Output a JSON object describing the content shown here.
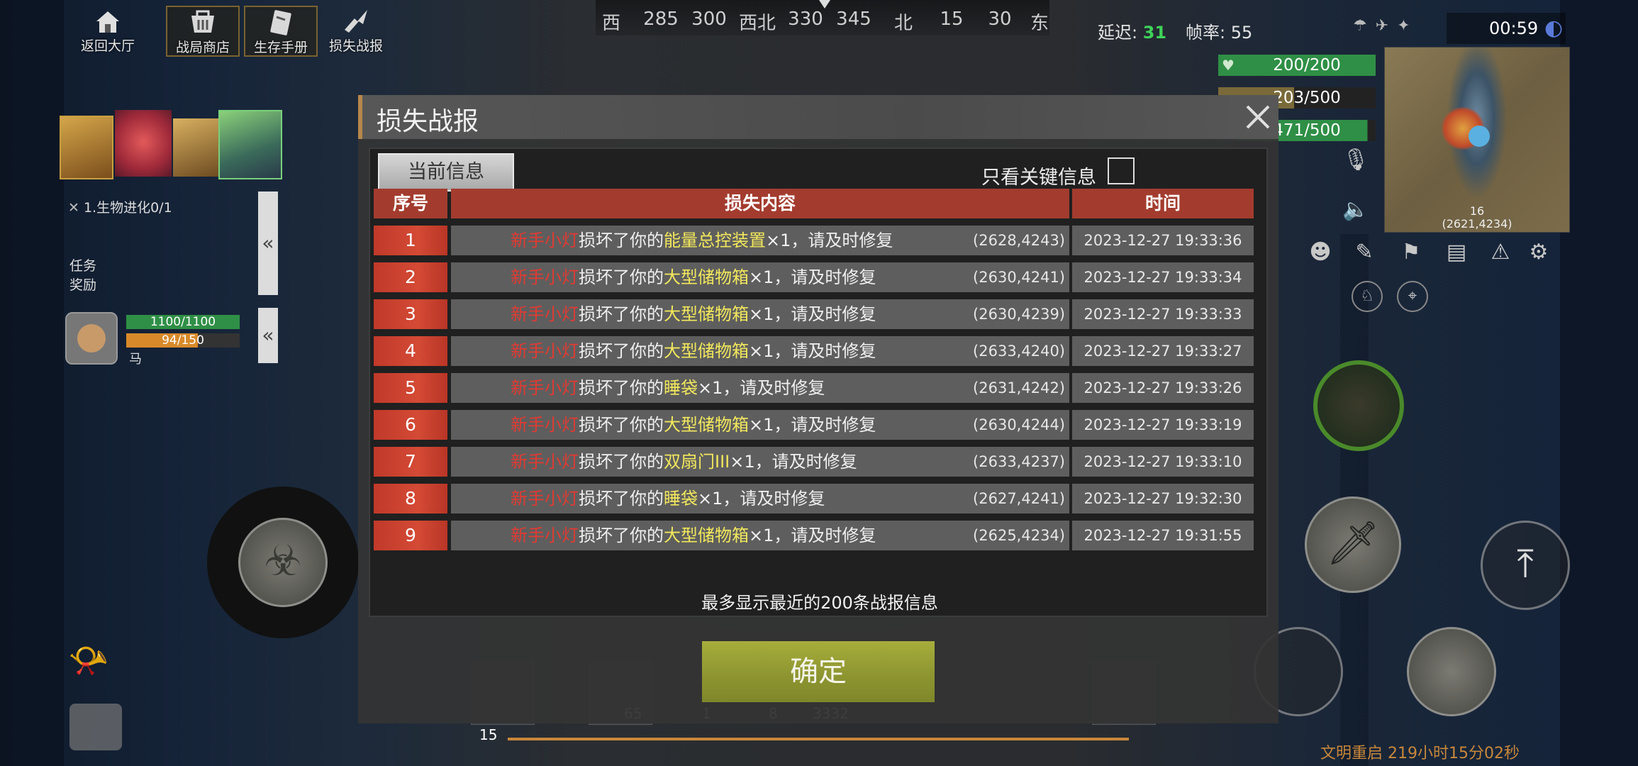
{
  "top_nav": [
    {
      "label": "返回大厅",
      "icon": "home-icon"
    },
    {
      "label": "战局商店",
      "icon": "shop-icon"
    },
    {
      "label": "生存手册",
      "icon": "book-icon"
    },
    {
      "label": "损失战报",
      "icon": "damage-report-icon"
    }
  ],
  "compass": {
    "marks": [
      "西",
      "285",
      "300",
      "西北",
      "330",
      "345",
      "北",
      "15",
      "30",
      "东"
    ]
  },
  "stats": {
    "latency_label": "延迟:",
    "latency_value": "31",
    "fps_label": "帧率:",
    "fps_value": "55",
    "clock": "00:59"
  },
  "vitals": {
    "health": "200/200",
    "hunger": "203/500",
    "water": "471/500"
  },
  "minimap": {
    "label_number": "16",
    "coordinates": "(2621,4234)"
  },
  "quest": {
    "objective": "1.生物进化0/1",
    "reward_label": "任务\n奖励"
  },
  "pet": {
    "hp": "1100/1100",
    "stamina": "94/150",
    "name": "马"
  },
  "modal": {
    "title": "损失战报",
    "tab_label": "当前信息",
    "filter_label": "只看关键信息",
    "filter_checked": false,
    "columns": [
      "序号",
      "损失内容",
      "时间"
    ],
    "rows": [
      {
        "index": "1",
        "actor": "新手小灯",
        "verb": "损坏了你的",
        "item": "能量总控装置",
        "tail": "×1，请及时修复",
        "coords": "(2628,4243)",
        "time": "2023-12-27 19:33:36"
      },
      {
        "index": "2",
        "actor": "新手小灯",
        "verb": "损坏了你的",
        "item": "大型储物箱",
        "tail": "×1，请及时修复",
        "coords": "(2630,4241)",
        "time": "2023-12-27 19:33:34"
      },
      {
        "index": "3",
        "actor": "新手小灯",
        "verb": "损坏了你的",
        "item": "大型储物箱",
        "tail": "×1，请及时修复",
        "coords": "(2630,4239)",
        "time": "2023-12-27 19:33:33"
      },
      {
        "index": "4",
        "actor": "新手小灯",
        "verb": "损坏了你的",
        "item": "大型储物箱",
        "tail": "×1，请及时修复",
        "coords": "(2633,4240)",
        "time": "2023-12-27 19:33:27"
      },
      {
        "index": "5",
        "actor": "新手小灯",
        "verb": "损坏了你的",
        "item": "睡袋",
        "tail": "×1，请及时修复",
        "coords": "(2631,4242)",
        "time": "2023-12-27 19:33:26"
      },
      {
        "index": "6",
        "actor": "新手小灯",
        "verb": "损坏了你的",
        "item": "大型储物箱",
        "tail": "×1，请及时修复",
        "coords": "(2630,4244)",
        "time": "2023-12-27 19:33:19"
      },
      {
        "index": "7",
        "actor": "新手小灯",
        "verb": "损坏了你的",
        "item": "双扇门III",
        "tail": "×1，请及时修复",
        "coords": "(2633,4237)",
        "time": "2023-12-27 19:33:10"
      },
      {
        "index": "8",
        "actor": "新手小灯",
        "verb": "损坏了你的",
        "item": "睡袋",
        "tail": "×1，请及时修复",
        "coords": "(2627,4241)",
        "time": "2023-12-27 19:32:30"
      },
      {
        "index": "9",
        "actor": "新手小灯",
        "verb": "损坏了你的",
        "item": "大型储物箱",
        "tail": "×1，请及时修复",
        "coords": "(2625,4234)",
        "time": "2023-12-27 19:31:55"
      }
    ],
    "footnote": "最多显示最近的200条战报信息",
    "confirm_label": "确定"
  },
  "hotbar": {
    "counts": [
      "65",
      "1",
      "8",
      "3332"
    ],
    "level": "15"
  },
  "server_timer": "文明重启 219小时15分02秒",
  "colors": {
    "accent_red": "#c0392a",
    "item_yellow": "#f2e85c",
    "actor_red": "#e23a32",
    "confirm_olive": "#8c9430",
    "health_green": "#2f8f46"
  }
}
